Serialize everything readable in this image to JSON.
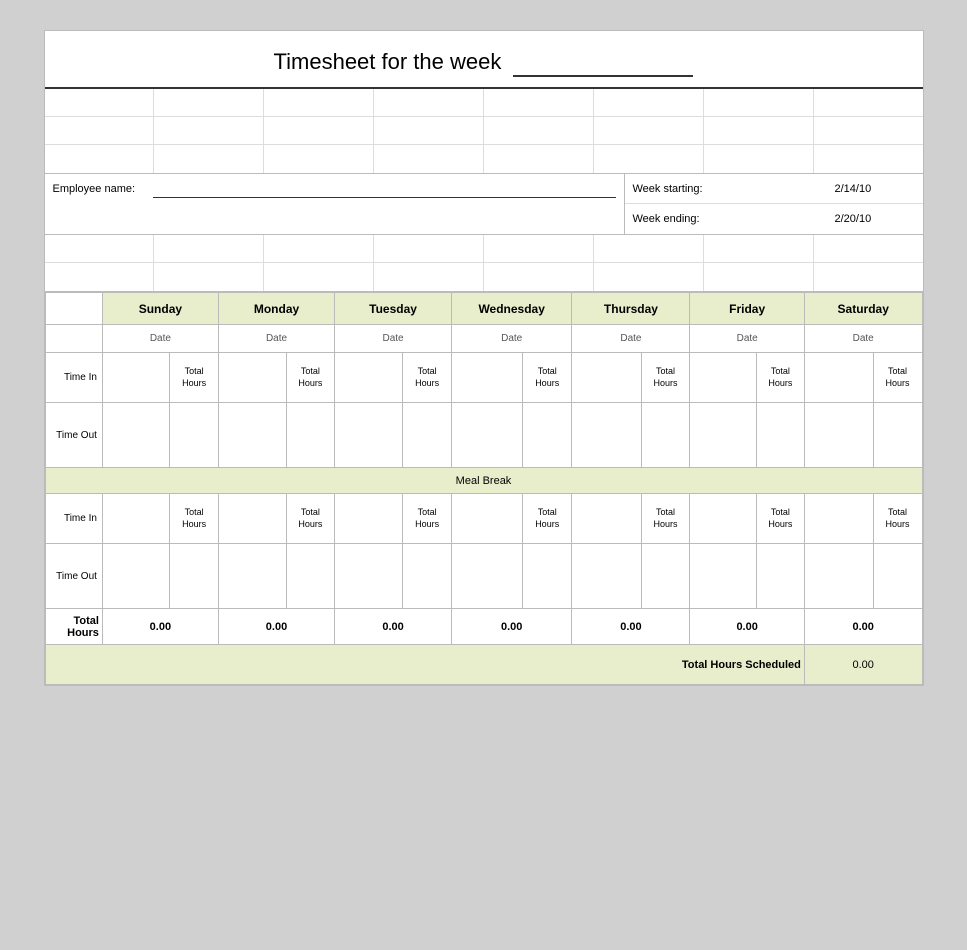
{
  "title": "Timesheet for the week",
  "employee_label": "Employee name:",
  "week_starting_label": "Week starting:",
  "week_starting_value": "2/14/10",
  "week_ending_label": "Week ending:",
  "week_ending_value": "2/20/10",
  "days": [
    "Sunday",
    "Monday",
    "Tuesday",
    "Wednesday",
    "Thursday",
    "Friday",
    "Saturday"
  ],
  "date_label": "Date",
  "time_in_label": "Time In",
  "time_out_label": "Time Out",
  "total_hours_label": "Total Hours",
  "hours_label": "Hours",
  "meal_break_label": "Meal Break",
  "total_row_label": "Total Hours",
  "total_values": [
    "0.00",
    "0.00",
    "0.00",
    "0.00",
    "0.00",
    "0.00",
    "0.00"
  ],
  "scheduled_label": "Total Hours Scheduled",
  "scheduled_value": "0.00"
}
